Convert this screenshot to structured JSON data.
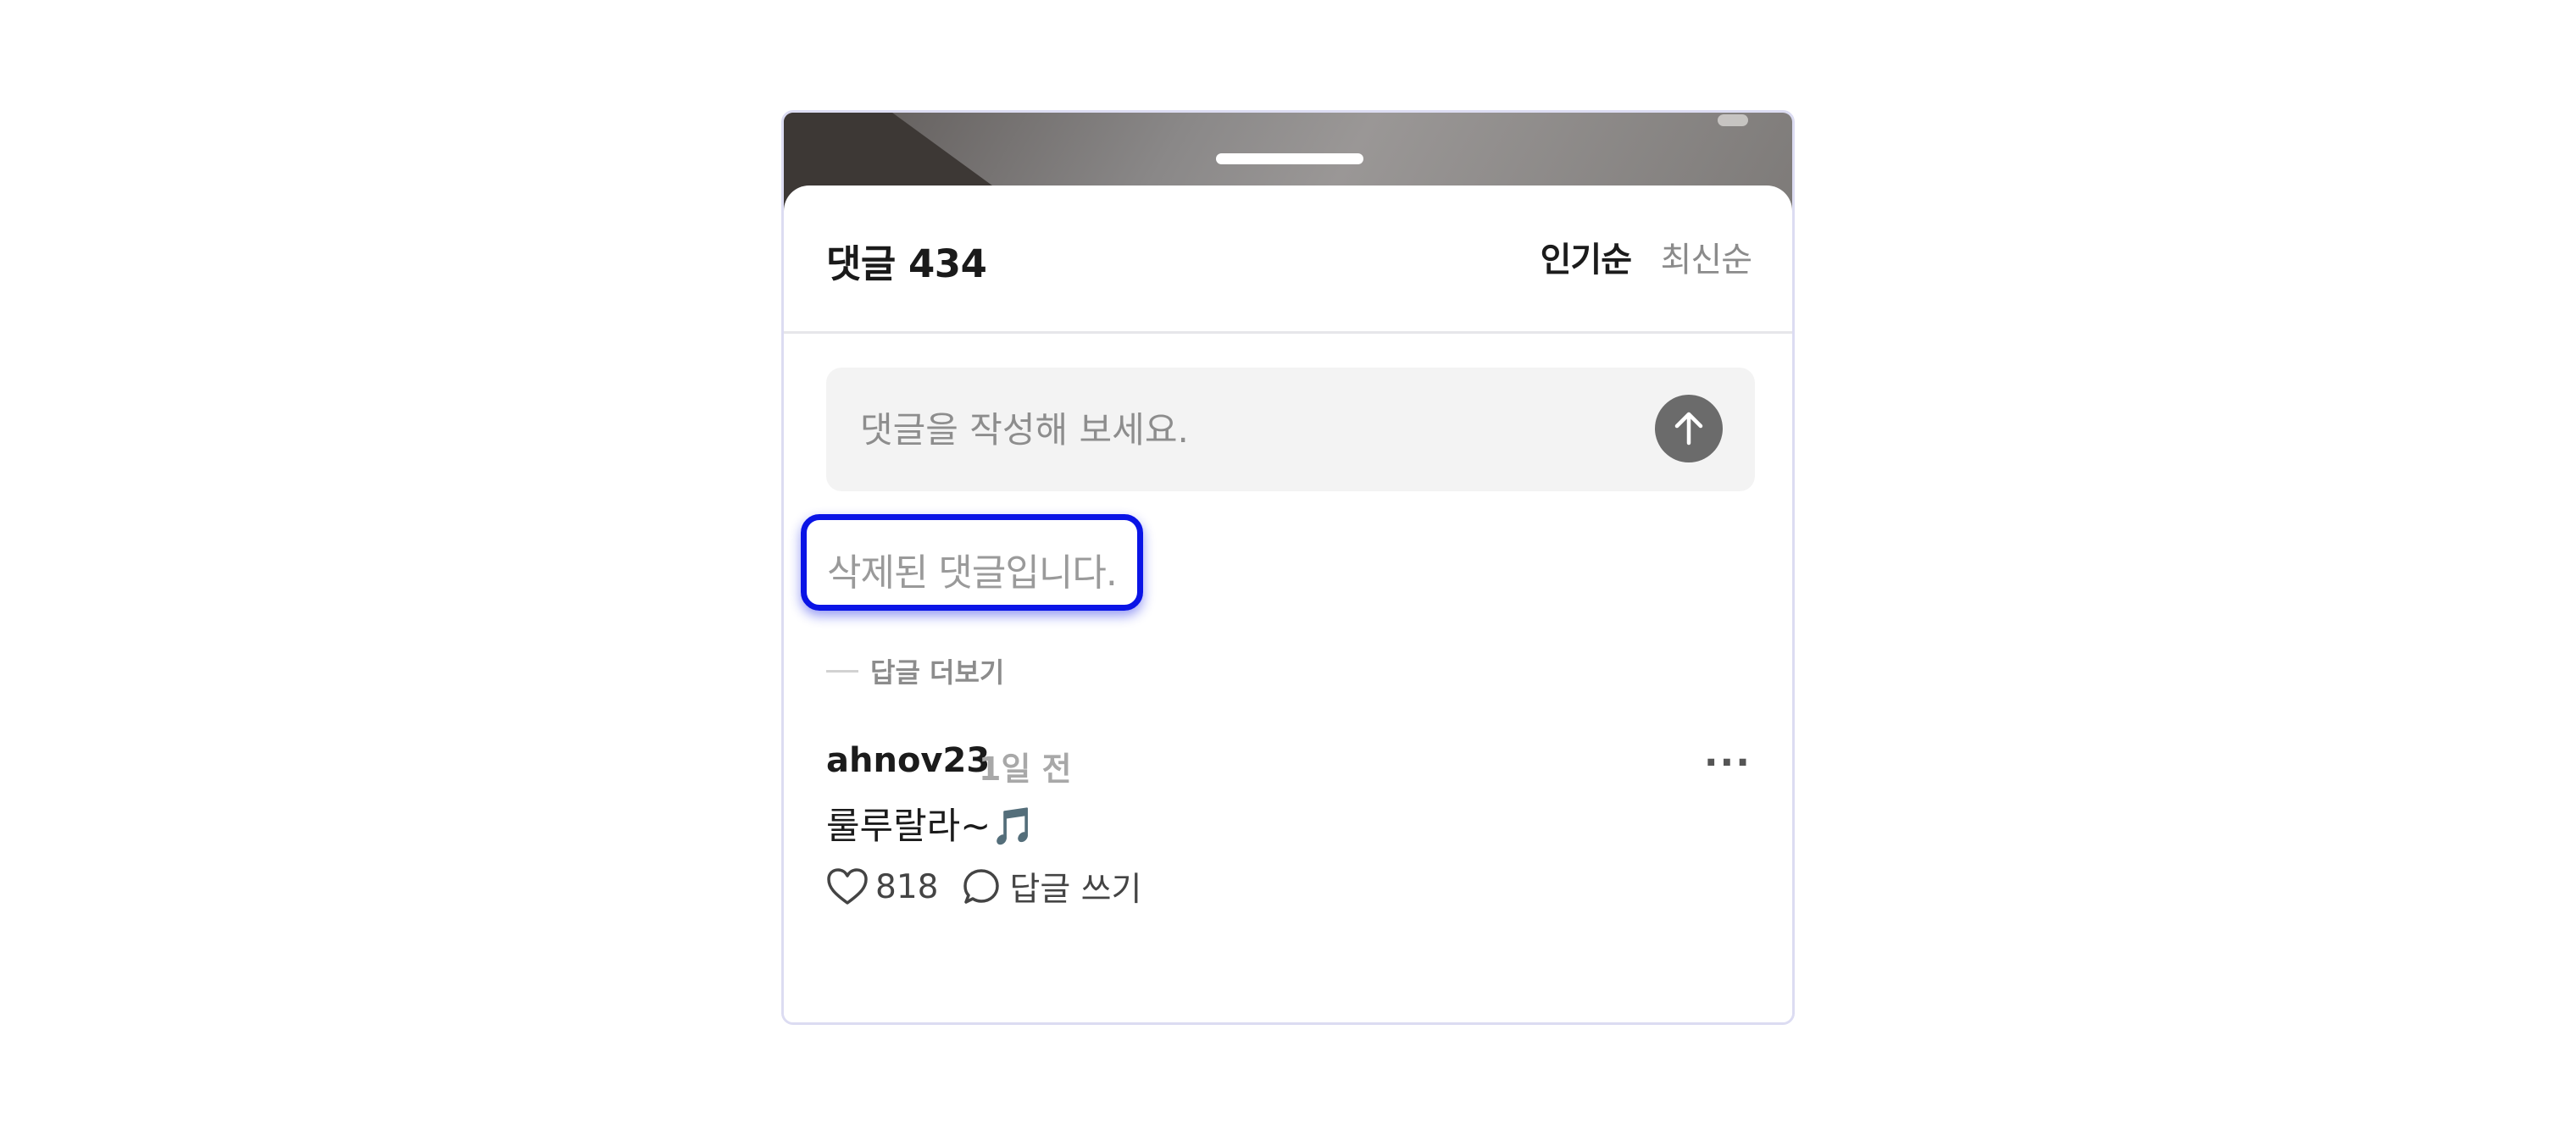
{
  "header": {
    "title": "댓글 434",
    "sort_popular": "인기순",
    "sort_latest": "최신순"
  },
  "composer": {
    "placeholder": "댓글을 작성해 보세요.",
    "send_icon": "arrow-up-icon"
  },
  "deleted_comment": {
    "text": "삭제된 댓글입니다."
  },
  "replies": {
    "more_label": "답글 더보기"
  },
  "comment": {
    "author": "ahnov23",
    "time": "1일 전",
    "text": "룰루랄라~🎵",
    "likes": "818",
    "reply_label": "답글 쓰기",
    "menu": "···"
  },
  "colors": {
    "highlight": "#0a14e6",
    "send_button": "#6b6b6b",
    "input_bg": "#f3f3f3"
  }
}
